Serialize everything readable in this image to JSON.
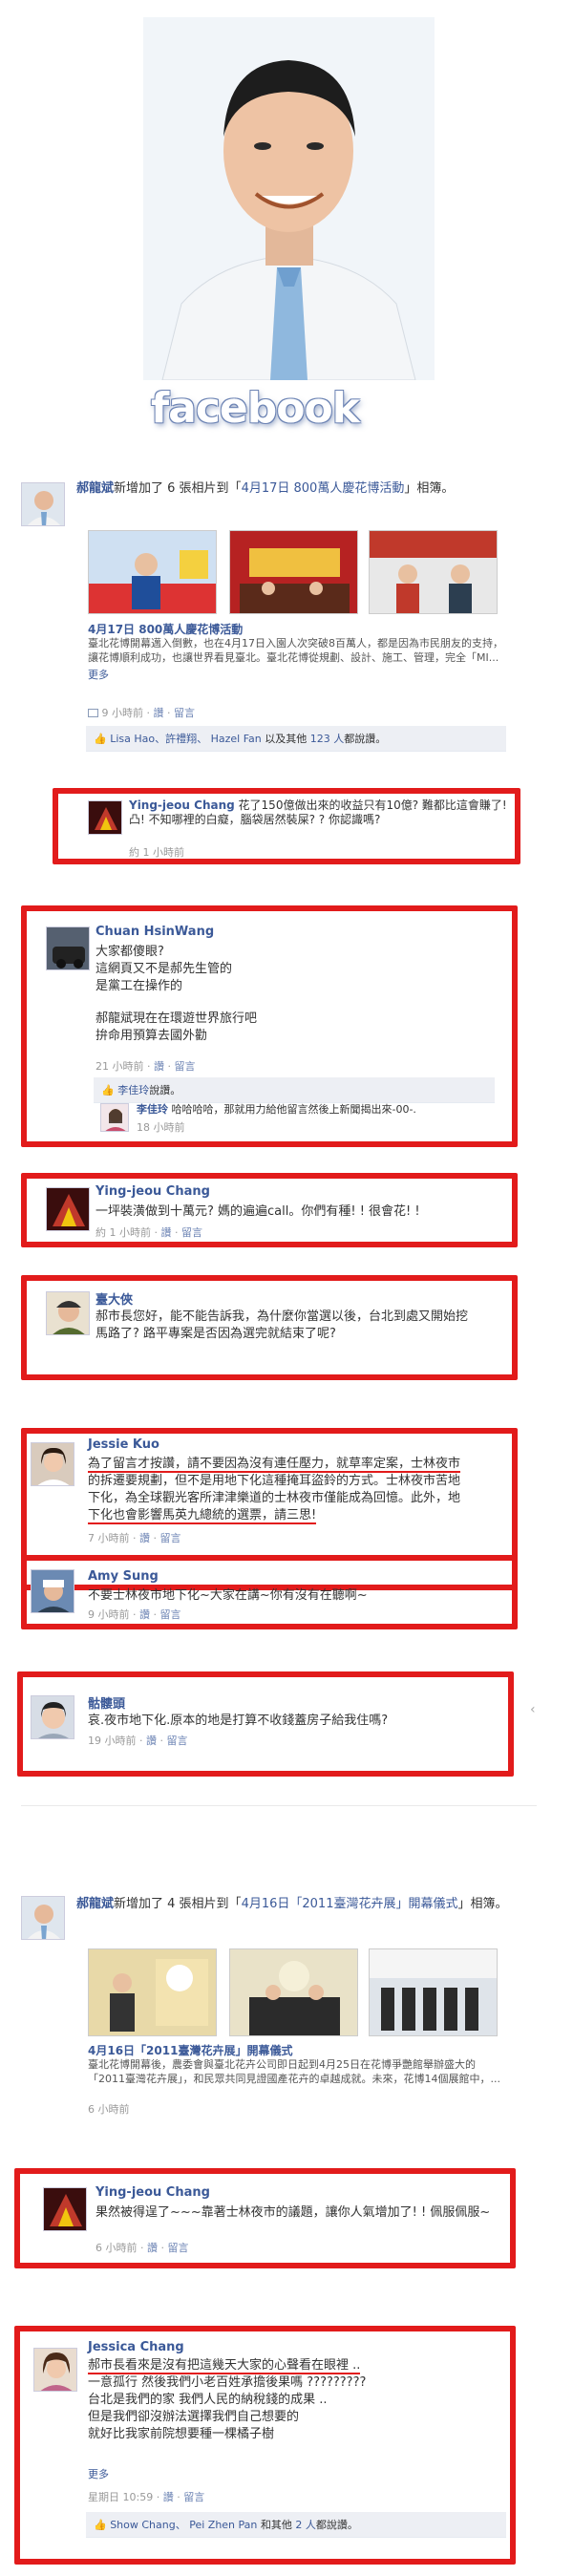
{
  "header": {
    "logo_text": "facebook"
  },
  "post1": {
    "author": "郝龍斌",
    "text_a": "新增加了 6 張相片到「",
    "album": "4月17日 800萬人慶花博活動",
    "text_b": "」相簿。",
    "album_title": "4月17日 800萬人慶花博活動",
    "desc": "臺北花博開幕邁入倒數，也在4月17日入園人次突破8百萬人，都是因為市民朋友的支持，讓花博順利成功，也讓世界看見臺北。臺北花博從規劃、設計、施工、管理，完全「MI...",
    "more": "更多",
    "time": "9 小時前",
    "actions": [
      "讚",
      "留言"
    ],
    "likes": {
      "names": "Lisa Hao、許禮翔、 Hazel Fan",
      "suffix": "以及其他",
      "count": "123 人",
      "tail": "都說讚。"
    },
    "comment": {
      "name": "Ying-jeou Chang",
      "text": "花了150億做出來的收益只有10億? 難都比這會賺了!\n凸! 不知哪裡的白癡，腦袋居然裝屎? ? 你認識嗎?",
      "time": "約 1 小時前"
    }
  },
  "c_chuan": {
    "name": "Chuan HsinWang",
    "lines": [
      "大家都傻眼?",
      "這網頁又不是郝先生管的",
      "是黨工在操作的",
      "",
      "郝龍斌現在在環遊世界旅行吧",
      "拚命用預算去國外勸"
    ],
    "time": "21 小時前",
    "actions": [
      "讚",
      "留言"
    ],
    "like": {
      "name": "李佳玲",
      "tail": "說讚。"
    },
    "reply": {
      "name": "李佳玲",
      "text": "哈哈哈哈，那就用力給他留言然後上新聞揭出來-00-.",
      "time": "18 小時前"
    }
  },
  "c_ying2": {
    "name": "Ying-jeou Chang",
    "text": "一坪裝潢做到十萬元? 媽的遍遍call。你們有種! ! 很會花! !",
    "time": "約 1 小時前",
    "actions": [
      "讚",
      "留言"
    ]
  },
  "c_daxia": {
    "name": "臺大俠",
    "lines": [
      "郝市長您好，能不能告訴我，為什麼你當選以後，台北到處又開始挖",
      "馬路了? 路平專案是否因為選完就結束了呢?"
    ]
  },
  "c_jessie": {
    "name": "Jessie Kuo",
    "lines": [
      "為了留言才按讚，請不要因為沒有連任壓力，就草率定案，士林夜市",
      "的拆遷要規劃，但不是用地下化這種掩耳盜鈴的方式。士林夜市苦地",
      "下化，為全球觀光客所津津樂道的士林夜市僅能成為回憶。此外，地",
      "下化也會影響馬英九總統的選票，請三思!"
    ],
    "time": "7 小時前",
    "actions": [
      "讚",
      "留言"
    ]
  },
  "c_amy": {
    "name": "Amy Sung",
    "text": "不要士林夜市地下化~大家在講~你有沒有在聽啊~",
    "time": "9 小時前",
    "actions": [
      "讚",
      "留言"
    ]
  },
  "c_skull": {
    "name": "骷髏頭",
    "text": "哀.夜市地下化.原本的地是打算不收錢蓋房子給我住嗎?",
    "time": "19 小時前",
    "actions": [
      "讚",
      "留言"
    ]
  },
  "post2": {
    "author": "郝龍斌",
    "text_a": "新增加了 4 張相片到「",
    "album": "4月16日「2011臺灣花卉展」開幕儀式",
    "text_b": "」相簿。",
    "album_title": "4月16日「2011臺灣花卉展」開幕儀式",
    "desc": "臺北花博開幕後，農委會與臺北花卉公司即日起到4月25日在花博爭艷館舉辦盛大的「2011臺灣花卉展」，和民眾共同見證國產花卉的卓越成就。未來，花博14個展館中，...",
    "time": "6 小時前"
  },
  "c_ying3": {
    "name": "Ying-jeou Chang",
    "text": "果然被得逞了~~~靠著士林夜市的議題，讓你人氣增加了! ! 佩服佩服~",
    "time": "6 小時前",
    "actions": [
      "讚",
      "留言"
    ]
  },
  "c_jessica": {
    "name": "Jessica Chang",
    "lines": [
      "郝市長看來是沒有把這幾天大家的心聲看在眼裡 ..",
      "一意孤行 然後我們小老百姓承擔後果嗎 ?????????",
      "台北是我們的家 我們人民的納稅錢的成果 ..",
      "但是我們卻沒辦法選擇我們自己想要的",
      "就好比我家前院想要種一棵橘子樹"
    ],
    "more": "更多",
    "time": "星期日 10:59",
    "actions": [
      "讚",
      "留言"
    ],
    "likes": {
      "names": "Show Chang、 Pei Zhen Pan",
      "suffix": "和其他",
      "count": "2 人",
      "tail": "都說讚。"
    }
  }
}
